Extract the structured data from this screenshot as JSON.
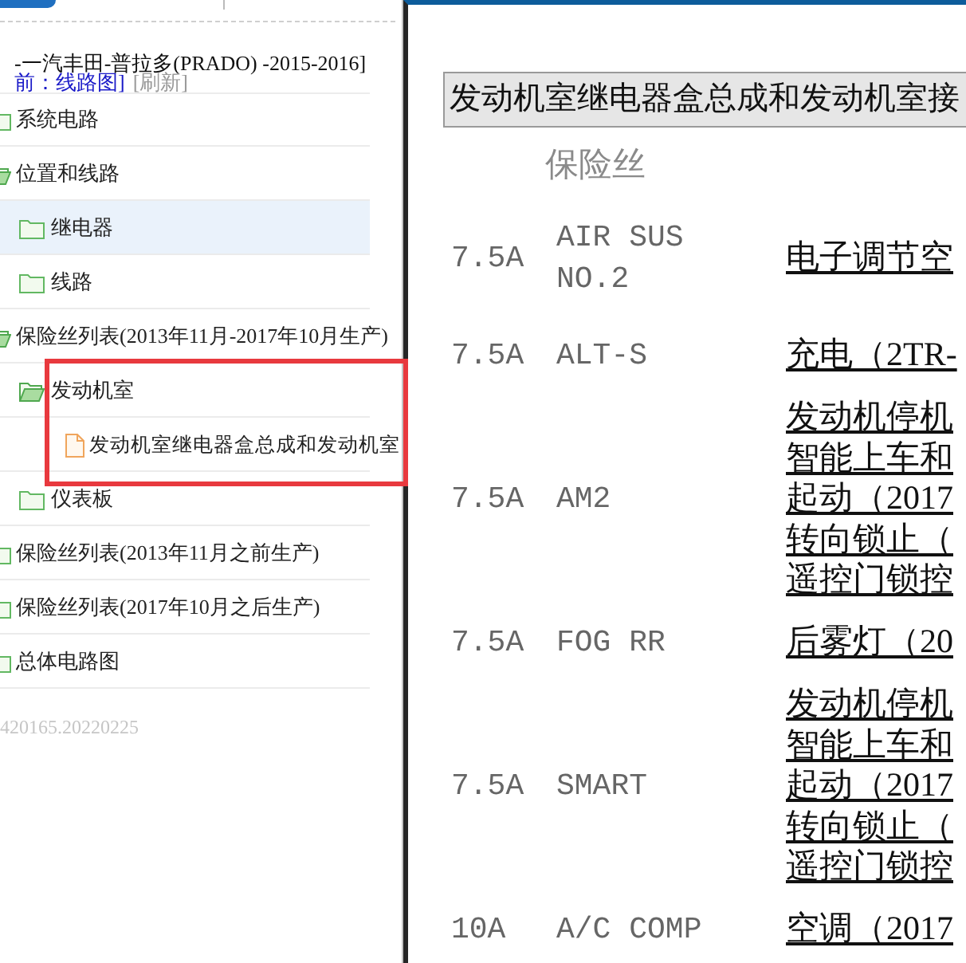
{
  "header": {
    "title": "-一汽丰田-普拉多(PRADO) -2015-2016]",
    "breadcrumb": "前：线路图]",
    "refresh_link": "[刷新]"
  },
  "tree": [
    {
      "label": "系统电路",
      "kind": "folder",
      "expanded": false,
      "selected": false
    },
    {
      "label": "位置和线路",
      "kind": "folder",
      "expanded": true,
      "selected": false,
      "children": [
        {
          "label": "继电器",
          "kind": "folder",
          "expanded": false,
          "selected": true
        },
        {
          "label": "线路",
          "kind": "folder",
          "expanded": false,
          "selected": false
        }
      ]
    },
    {
      "label": "保险丝列表(2013年11月-2017年10月生产)",
      "kind": "folder",
      "expanded": true,
      "selected": false,
      "children": [
        {
          "label": "发动机室",
          "kind": "folder",
          "expanded": true,
          "selected": false,
          "children": [
            {
              "label": "发动机室继电器盒总成和发动机室",
              "kind": "file",
              "selected": false
            }
          ]
        },
        {
          "label": "仪表板",
          "kind": "folder",
          "expanded": false,
          "selected": false
        }
      ]
    },
    {
      "label": "保险丝列表(2013年11月之前生产)",
      "kind": "folder",
      "expanded": false,
      "selected": false
    },
    {
      "label": "保险丝列表(2017年10月之后生产)",
      "kind": "folder",
      "expanded": false,
      "selected": false
    },
    {
      "label": "总体电路图",
      "kind": "folder",
      "expanded": false,
      "selected": false
    }
  ],
  "version": "420165.20220225",
  "document": {
    "heading": "发动机室继电器盒总成和发动机室接",
    "column_header": "保险丝",
    "fuses": [
      {
        "rating": "7.5A",
        "name": "AIR SUS NO.2",
        "circuit": [
          "电子调节空"
        ]
      },
      {
        "rating": "7.5A",
        "name": "ALT-S",
        "circuit": [
          "充电（2TR-"
        ]
      },
      {
        "rating": "7.5A",
        "name": "AM2",
        "circuit": [
          "发动机停机",
          "智能上车和",
          "起动（2017",
          "转向锁止（",
          "遥控门锁控"
        ]
      },
      {
        "rating": "7.5A",
        "name": "FOG RR",
        "circuit": [
          "后雾灯（20"
        ]
      },
      {
        "rating": "7.5A",
        "name": "SMART",
        "circuit": [
          "发动机停机",
          "智能上车和",
          "起动（2017",
          "转向锁止（",
          "遥控门锁控"
        ]
      },
      {
        "rating": "10A",
        "name": "A/C COMP",
        "circuit": [
          "空调（2017"
        ]
      }
    ]
  }
}
